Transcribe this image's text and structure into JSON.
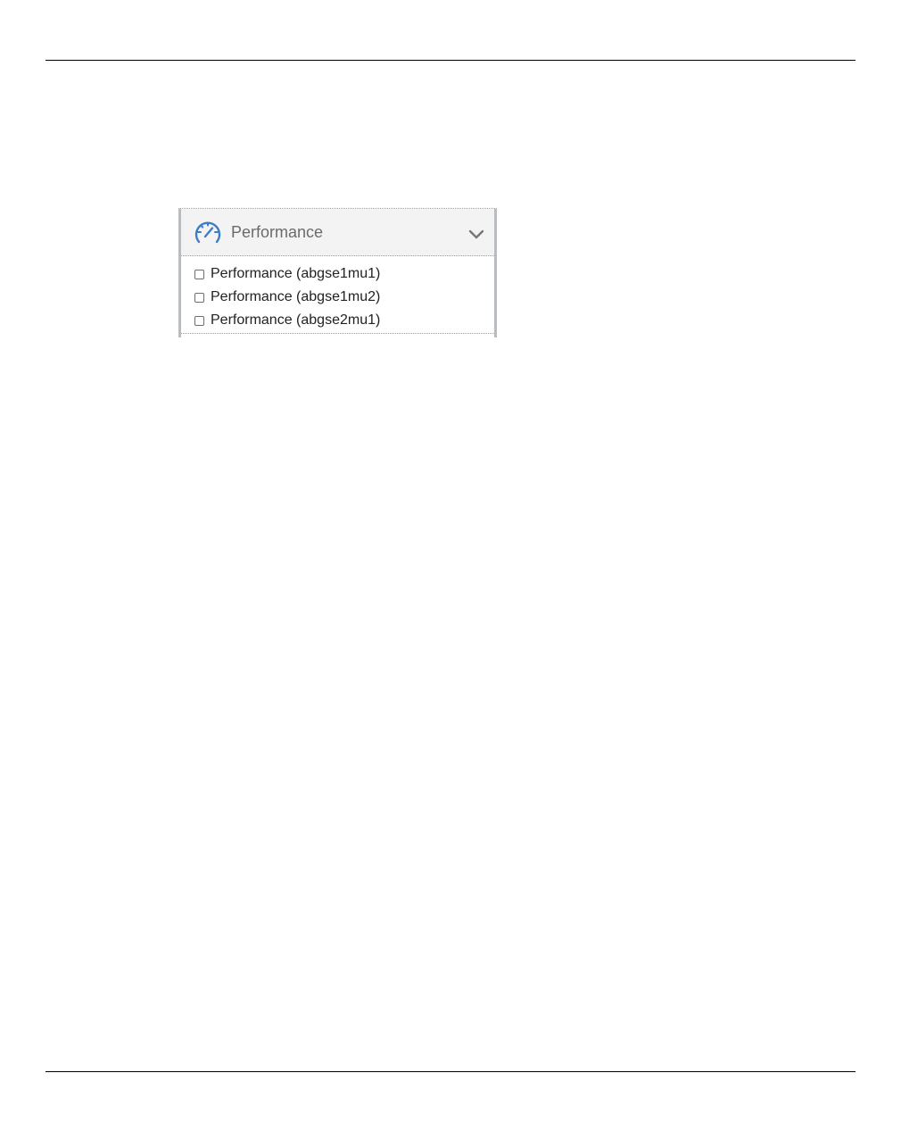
{
  "panel": {
    "title": "Performance",
    "icon": "speedometer-icon",
    "accent_color": "#3d7cc9",
    "toggle_icon": "chevron-down-icon",
    "items": [
      {
        "label": "Performance (abgse1mu1)",
        "checked": false
      },
      {
        "label": "Performance (abgse1mu2)",
        "checked": false
      },
      {
        "label": "Performance (abgse2mu1)",
        "checked": false
      }
    ]
  }
}
